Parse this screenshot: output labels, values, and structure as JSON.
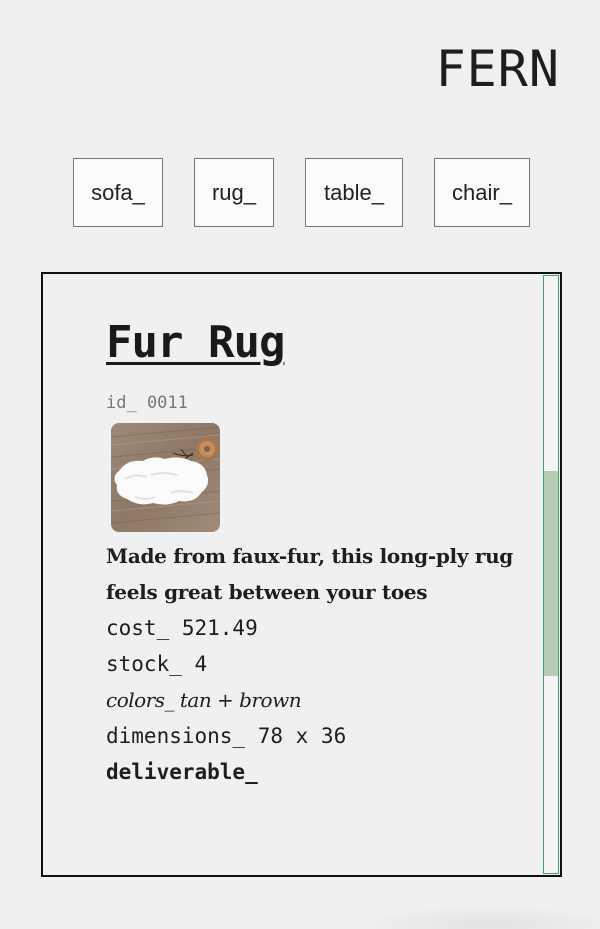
{
  "brand": "FERN",
  "nav": {
    "items": [
      {
        "label": "sofa_"
      },
      {
        "label": "rug_"
      },
      {
        "label": "table_"
      },
      {
        "label": "chair_"
      }
    ]
  },
  "product": {
    "title": "Fur Rug",
    "id_label": "id_ 0011",
    "image_alt": "white faux-fur rug on wooden floor",
    "description": "Made from faux-fur, this long-ply rug feels great between your toes",
    "cost": "cost_ 521.49",
    "stock": "stock_ 4",
    "colors": "colors_ tan + brown",
    "dimensions": "dimensions_ 78 x 36",
    "deliverable": "deliverable_"
  },
  "scrollbar": {
    "accent": "#3fa56b",
    "thumb_color": "#b5cdb0"
  }
}
